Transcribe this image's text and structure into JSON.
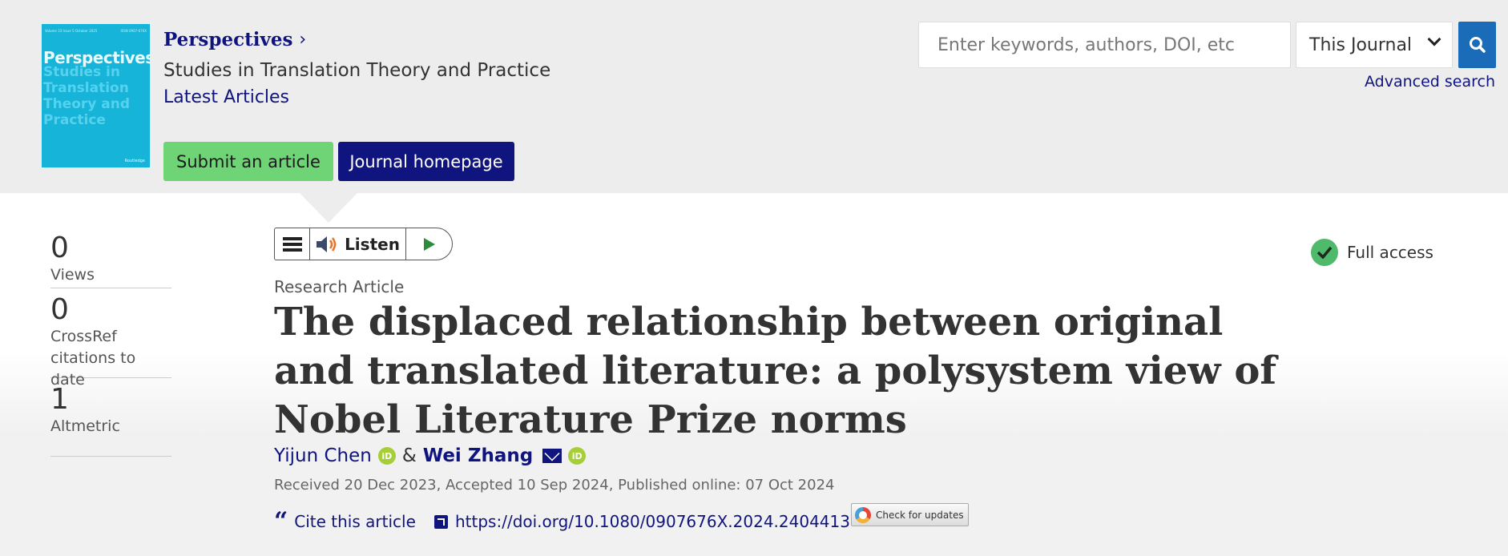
{
  "cover": {
    "top_left": "Volume 33 Issue 5 October 2025",
    "top_right": "ISSN 0907-676X",
    "title": "Perspectives:",
    "subtitle": "Studies in Translation Theory and Practice",
    "publisher": "Routledge"
  },
  "journal": {
    "name": "Perspectives",
    "subtitle": "Studies in Translation Theory and Practice",
    "latest_link": "Latest Articles"
  },
  "buttons": {
    "submit": "Submit an article",
    "homepage": "Journal homepage"
  },
  "search": {
    "placeholder": "Enter keywords, authors, DOI, etc",
    "scope_selected": "This Journal",
    "advanced": "Advanced search"
  },
  "metrics": [
    {
      "value": "0",
      "label": "Views"
    },
    {
      "value": "0",
      "label": "CrossRef citations to date"
    },
    {
      "value": "1",
      "label": "Altmetric"
    }
  ],
  "listen": {
    "label": "Listen"
  },
  "access": {
    "label": "Full access"
  },
  "article": {
    "type": "Research Article",
    "title": "The displaced relationship between original and translated literature: a polysystem view of Nobel Literature Prize norms",
    "authors": [
      "Yijun Chen",
      "Wei Zhang"
    ],
    "author_separator": "&",
    "dates": "Received 20 Dec 2023, Accepted 10 Sep 2024, Published online: 07 Oct 2024",
    "cite_label": "Cite this article",
    "doi": "https://doi.org/10.1080/0907676X.2024.2404413",
    "updates_label": "Check for updates"
  },
  "colors": {
    "brand_navy": "#10147e",
    "submit_green": "#6ed476",
    "search_blue": "#1a6bb8",
    "access_green": "#4fb96c",
    "orcid_green": "#a6ce39",
    "cover_cyan": "#16b4d8"
  },
  "icons": {
    "search": "search-icon",
    "menu": "hamburger-icon",
    "speaker": "speaker-icon",
    "play": "play-icon",
    "check": "check-icon",
    "orcid": "orcid-icon",
    "mail": "mail-icon",
    "quote": "quote-icon",
    "external": "external-link-icon"
  }
}
